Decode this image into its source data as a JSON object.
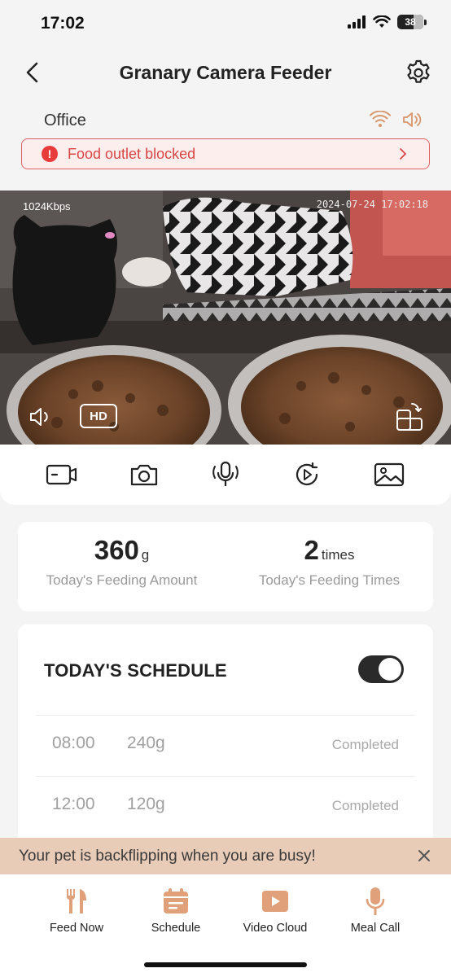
{
  "status_bar": {
    "time": "17:02",
    "battery_level": "38"
  },
  "header": {
    "title": "Granary Camera Feeder",
    "back_icon": "chevron-left-icon",
    "settings_icon": "gear-icon"
  },
  "device": {
    "location": "Office",
    "wifi_icon": "wifi-icon",
    "speaker_icon": "speaker-icon"
  },
  "alert": {
    "text": "Food outlet blocked",
    "icon": "exclamation-icon",
    "accent_color": "#e83c3c"
  },
  "video": {
    "bitrate": "1024Kbps",
    "timestamp": "2024-07-24 17:02:18",
    "quality_label": "HD"
  },
  "actions": [
    {
      "icon": "record-video-icon"
    },
    {
      "icon": "camera-icon"
    },
    {
      "icon": "microphone-icon"
    },
    {
      "icon": "playback-icon"
    },
    {
      "icon": "gallery-icon"
    }
  ],
  "summary": {
    "amount_value": "360",
    "amount_unit": "g",
    "amount_label": "Today's Feeding Amount",
    "times_value": "2",
    "times_unit": "times",
    "times_label": "Today's Feeding Times"
  },
  "schedule": {
    "title": "TODAY'S SCHEDULE",
    "enabled": true,
    "rows": [
      {
        "time": "08:00",
        "amount": "240g",
        "status": "Completed"
      },
      {
        "time": "12:00",
        "amount": "120g",
        "status": "Completed"
      }
    ]
  },
  "promo": {
    "text": "Your pet is backflipping when you are busy!"
  },
  "tabs": [
    {
      "label": "Feed Now",
      "icon": "fork-knife-icon"
    },
    {
      "label": "Schedule",
      "icon": "calendar-icon"
    },
    {
      "label": "Video Cloud",
      "icon": "play-icon"
    },
    {
      "label": "Meal Call",
      "icon": "microphone-icon"
    }
  ],
  "colors": {
    "accent": "#e0a07a",
    "alert": "#e83c3c",
    "banner": "#e8ccb7"
  }
}
